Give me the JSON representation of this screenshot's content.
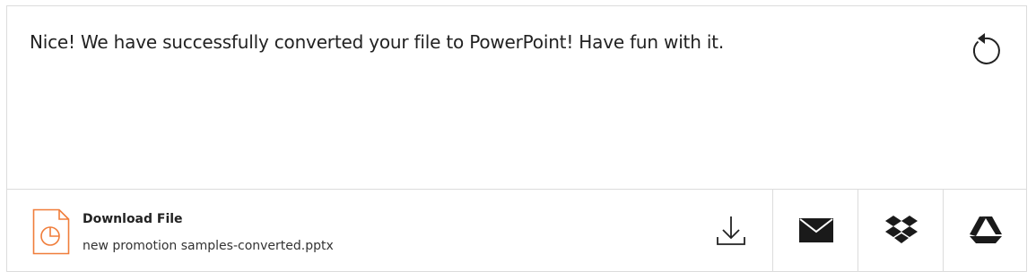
{
  "message": "Nice! We have successfully converted your file to PowerPoint! Have fun with it.",
  "file": {
    "title": "Download File",
    "name": "new promotion samples-converted.pptx",
    "icon": "pptx-file-icon",
    "accent_color": "#f07d3a"
  },
  "actions": [
    {
      "name": "download",
      "icon": "download-icon"
    },
    {
      "name": "email",
      "icon": "envelope-icon"
    },
    {
      "name": "dropbox",
      "icon": "dropbox-icon"
    },
    {
      "name": "google-drive",
      "icon": "google-drive-icon"
    }
  ],
  "restart_icon": "restart-icon"
}
